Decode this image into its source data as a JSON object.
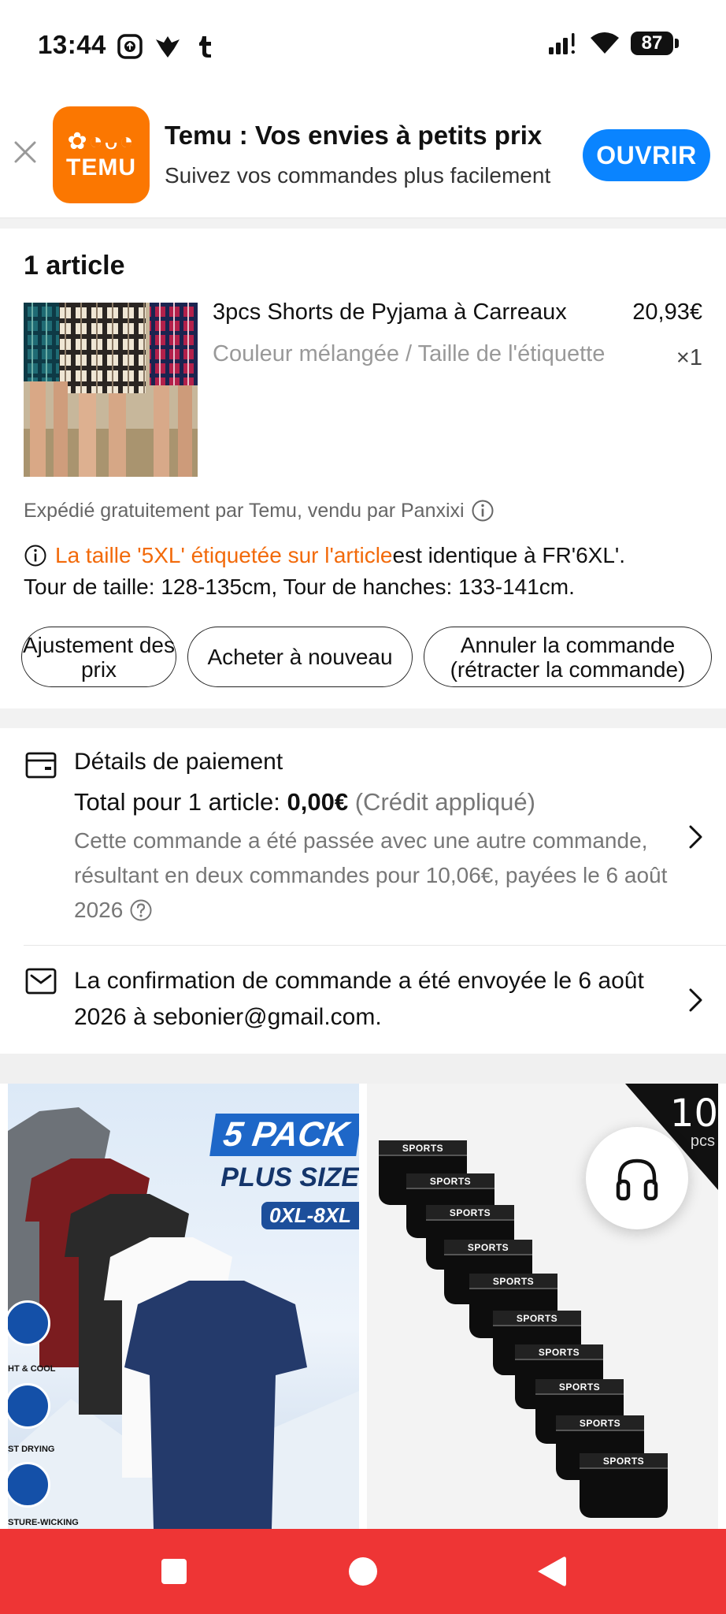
{
  "status_bar": {
    "time": "13:44",
    "battery": "87"
  },
  "app_banner": {
    "title": "Temu : Vos envies à petits prix",
    "subtitle": "Suivez vos commandes plus facilement",
    "open_button": "OUVRIR",
    "logo_text": "TEMU"
  },
  "article": {
    "count_label": "1 article",
    "product_name": "3pcs Shorts de Pyjama à Carreaux",
    "price": "20,93€",
    "variant": "Couleur mélangée / Taille de l'étiquette",
    "quantity": "×1",
    "shipping_note": "Expédié gratuitement par Temu, vendu par Panxixi",
    "size_highlight": "La taille '5XL' étiquetée sur l'article",
    "size_rest": " est identique à FR'6XL'.",
    "size_measures": "Tour de taille: 128-135cm, Tour de hanches: 133-141cm.",
    "actions": [
      "Ajustement des prix",
      "Acheter à nouveau",
      "Annuler la commande (rétracter la commande)"
    ]
  },
  "payment": {
    "title": "Détails de paiement",
    "total_label": "Total pour 1 article: ",
    "total_value": "0,00€",
    "credit_note": "(Crédit appliqué)",
    "note": "Cette commande a été passée avec une autre commande, résultant en deux commandes pour 10,06€, payées le 6 août 2026"
  },
  "confirmation": {
    "text": "La confirmation de commande a été envoyée le 6 août 2026 à sebonier@gmail.com."
  },
  "recommendations": [
    {
      "pack": "5 PACK",
      "plus": "PLUS SIZE",
      "sizes": "0XL-8XL",
      "features": [
        "HT & COOL",
        "ST DRYING",
        "STURE-WICKING"
      ]
    },
    {
      "badge": "10",
      "badge_sub": "pcs",
      "band_text": "SPORTS"
    }
  ],
  "colors": {
    "temu_orange": "#fb7701",
    "open_blue": "#0a84ff",
    "highlight_orange": "#f26a0a",
    "nav_red": "#ee3535"
  }
}
